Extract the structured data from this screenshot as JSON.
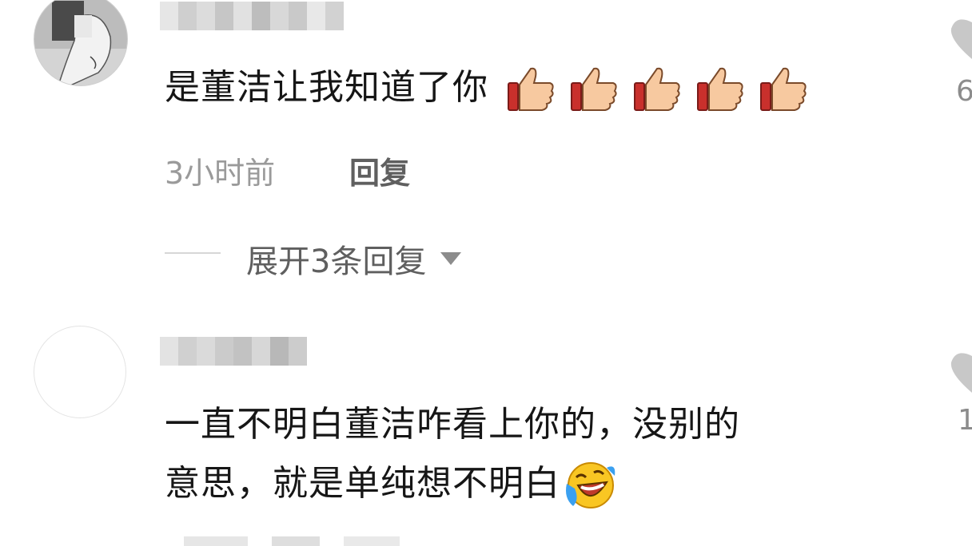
{
  "comments": [
    {
      "text": "是董洁让我知道了你",
      "emojis": [
        "thumbs-up",
        "thumbs-up",
        "thumbs-up",
        "thumbs-up",
        "thumbs-up"
      ],
      "time": "3小时前",
      "reply_label": "回复",
      "expand_label": "展开3条回复",
      "like_count": "6"
    },
    {
      "line1": "一直不明白董洁咋看上你的，没别的",
      "line2": "意思，就是单纯想不明白",
      "emoji": "laughing-tears",
      "like_count": "1"
    }
  ],
  "colors": {
    "text": "#161616",
    "meta": "#9a9a9a",
    "reply": "#5f5f5f",
    "divider": "#d6d6d6"
  }
}
